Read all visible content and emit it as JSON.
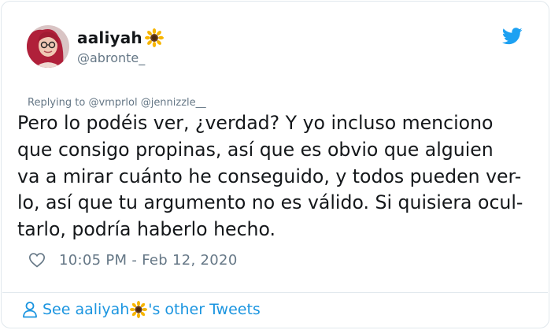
{
  "tweet": {
    "display_name": "aaliyah",
    "name_emoji": "sunflower-icon",
    "handle": "@abronte_",
    "reply_prefix": "Replying to",
    "reply_users": "@vmprlol @jennizzle__",
    "text_lines": [
      "Pero lo podéis ver, ¿verdad? Y yo incluso menciono",
      "que consigo propinas, así que es obvio que alguien",
      "va a mirar cuánto he conseguido, y todos pueden ver-",
      "lo, así que tu argumento no es válido. Si quisiera ocul-",
      "tarlo, podría haberlo hecho."
    ],
    "timestamp": "10:05 PM - Feb 12, 2020"
  },
  "footer": {
    "see_prefix": "See aaliyah",
    "see_suffix": "'s other Tweets"
  },
  "colors": {
    "accent": "#1b95e0",
    "twitter_blue": "#1da1f2",
    "muted": "#657786",
    "text": "#14171a",
    "border": "#e1e8ed"
  },
  "icons": [
    "twitter-bird-icon",
    "heart-icon",
    "user-icon",
    "sunflower-icon"
  ]
}
